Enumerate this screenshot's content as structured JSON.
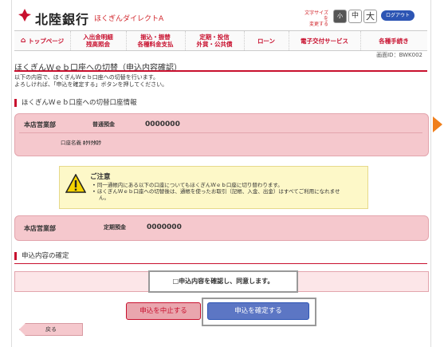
{
  "header": {
    "bank_name": "北陸銀行",
    "service_name": "ほくぎんダイレクトA",
    "font_size_label_1": "文字サイズを",
    "font_size_label_2": "変更する",
    "font_small": "小",
    "font_mid": "中",
    "font_large": "大",
    "logout": "ログアウト"
  },
  "nav": {
    "items": [
      {
        "label": "トップページ",
        "icon": "home-icon"
      },
      {
        "label": "入出金明細\n残高照会"
      },
      {
        "label": "振込・振替\n各種料金支払"
      },
      {
        "label": "定期・投信\n外貨・公共債"
      },
      {
        "label": "ローン"
      },
      {
        "label": "電子交付サービス"
      },
      {
        "label": "各種手続き"
      }
    ]
  },
  "page": {
    "screen_id": "画面ID：BWK002",
    "title": "ほくぎんＷｅｂ口座への切替（申込内容確認）",
    "intro_1": "以下の内容で、ほくぎんＷｅｂ口座への切替を行います。",
    "intro_2": "よろしければ、「申込を確定する」ボタンを押してください。"
  },
  "account_section": {
    "heading": "ほくぎんＷｅｂ口座への切替口座情報",
    "account1": {
      "branch": "本店営業部",
      "type": "普通預金",
      "number": "0000000",
      "name_label": "口座名義",
      "name_value": "ﾎｸﾘｸﾀﾛｳ"
    },
    "account2": {
      "branch": "本店営業部",
      "type": "定期預金",
      "number": "0000000"
    }
  },
  "caution": {
    "title": "ご注意",
    "line1": "• 同一通帳内にある以下の口座についてもほくぎんＷｅｂ口座に切り替わります。",
    "line2": "• ほくぎんＷｅｂ口座への切替後は、通帳を使ったお取引（記帳、入金、出金）はすべてご利用になれませ",
    "line3": "ん。"
  },
  "confirm_section": {
    "heading": "申込内容の確定",
    "checkbox_label": "□申込内容を確認し、同意します。"
  },
  "buttons": {
    "cancel": "申込を中止する",
    "confirm": "申込を確定する",
    "back": "戻る"
  },
  "colors": {
    "brand_red": "#c8102e",
    "accent_blue": "#2d55b4",
    "pink_box": "#f5c8cd",
    "caution_yellow": "#fdf8c8",
    "side_arrow": "#f07f1c"
  }
}
